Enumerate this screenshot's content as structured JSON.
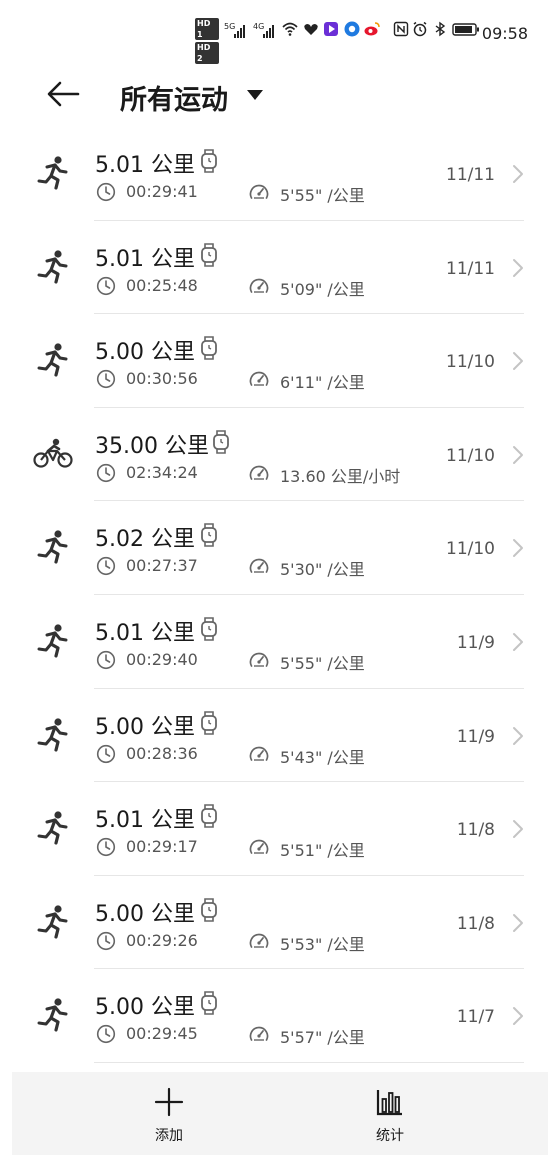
{
  "status_bar": {
    "hd1": "HD 1",
    "hd2": "HD 2",
    "net1": "5G",
    "net2": "4G",
    "time": "09:58"
  },
  "header": {
    "title": "所有运动"
  },
  "activities": [
    {
      "sport": "run-icon",
      "distance": "5.01 公里",
      "duration": "00:29:41",
      "pace": "5'55\" /公里",
      "date": "11/11"
    },
    {
      "sport": "run-icon",
      "distance": "5.01 公里",
      "duration": "00:25:48",
      "pace": "5'09\" /公里",
      "date": "11/11"
    },
    {
      "sport": "run-icon",
      "distance": "5.00 公里",
      "duration": "00:30:56",
      "pace": "6'11\" /公里",
      "date": "11/10"
    },
    {
      "sport": "bike-icon",
      "distance": "35.00 公里",
      "duration": "02:34:24",
      "pace": "13.60 公里/小时",
      "date": "11/10"
    },
    {
      "sport": "run-icon",
      "distance": "5.02 公里",
      "duration": "00:27:37",
      "pace": "5'30\" /公里",
      "date": "11/10"
    },
    {
      "sport": "run-icon",
      "distance": "5.01 公里",
      "duration": "00:29:40",
      "pace": "5'55\" /公里",
      "date": "11/9"
    },
    {
      "sport": "run-icon",
      "distance": "5.00 公里",
      "duration": "00:28:36",
      "pace": "5'43\" /公里",
      "date": "11/9"
    },
    {
      "sport": "run-icon",
      "distance": "5.01 公里",
      "duration": "00:29:17",
      "pace": "5'51\" /公里",
      "date": "11/8"
    },
    {
      "sport": "run-icon",
      "distance": "5.00 公里",
      "duration": "00:29:26",
      "pace": "5'53\" /公里",
      "date": "11/8"
    },
    {
      "sport": "run-icon",
      "distance": "5.00 公里",
      "duration": "00:29:45",
      "pace": "5'57\" /公里",
      "date": "11/7"
    }
  ],
  "bottom_bar": {
    "add_label": "添加",
    "stats_label": "统计"
  }
}
